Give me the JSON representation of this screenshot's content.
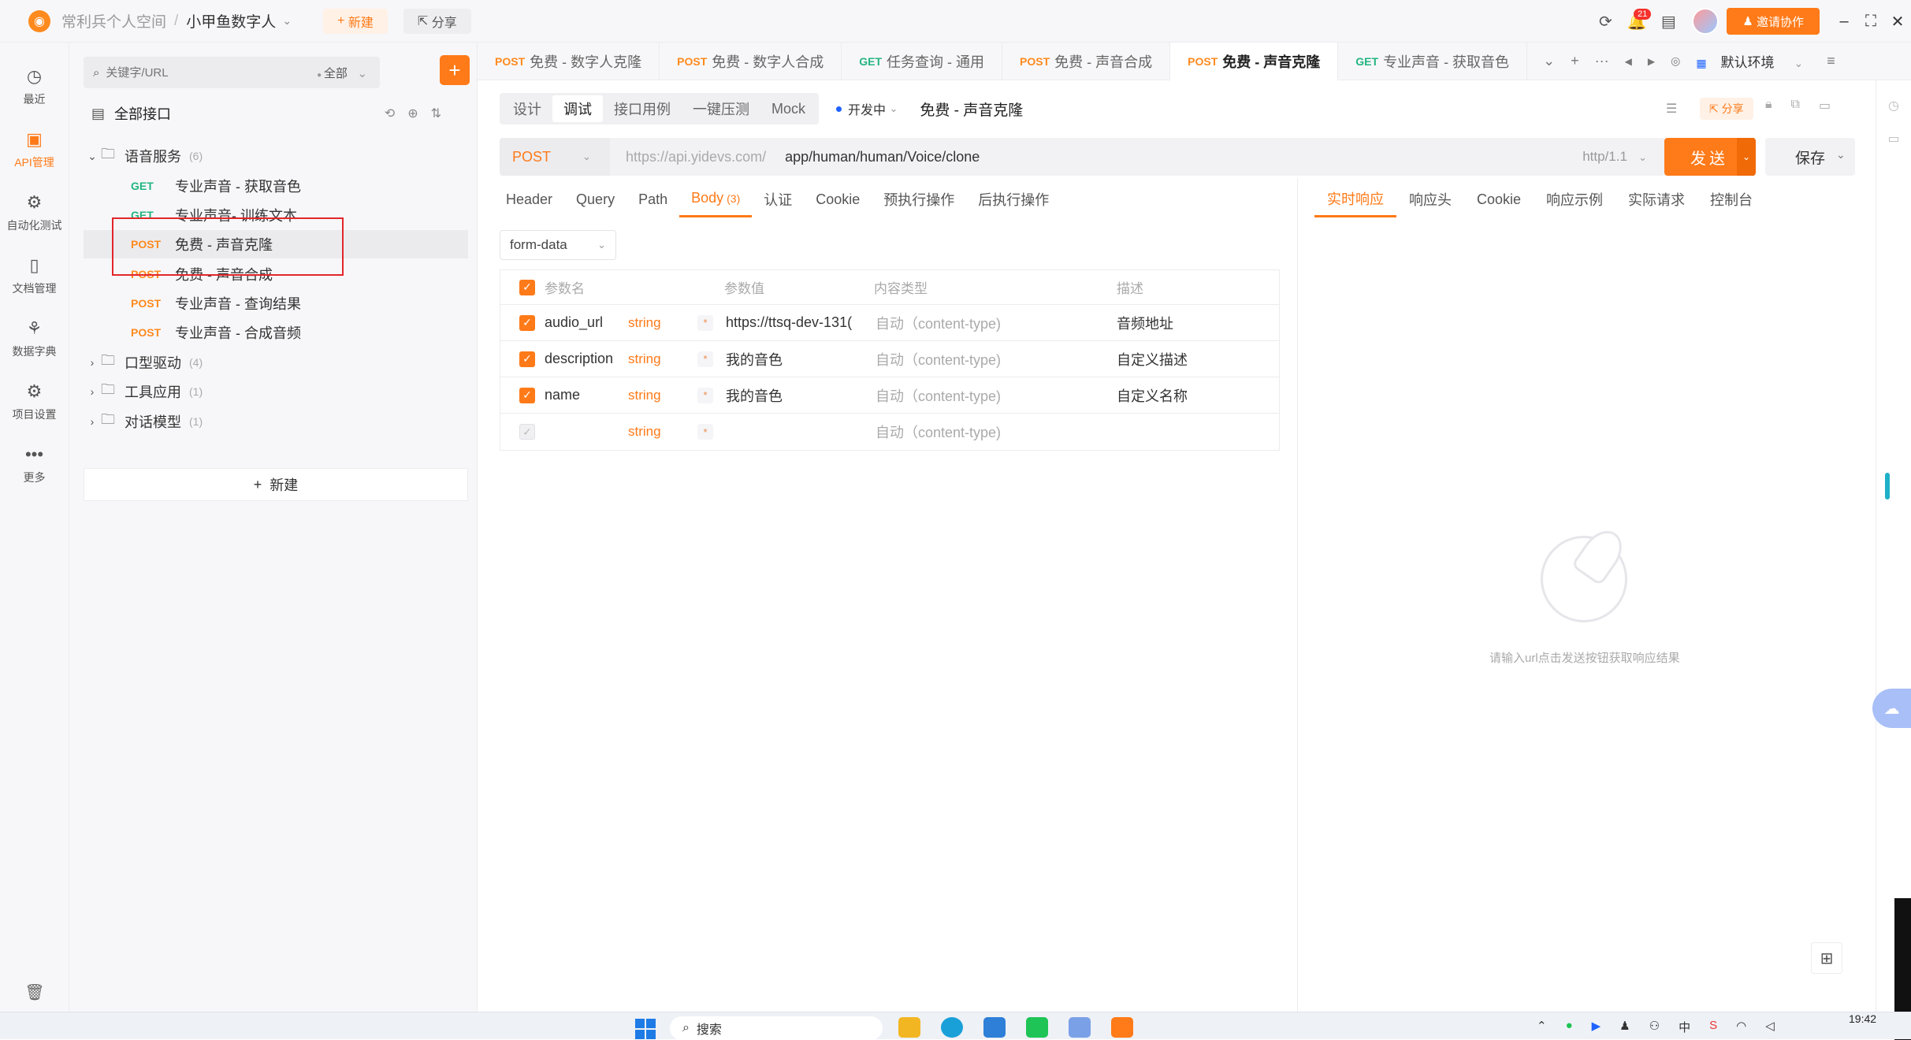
{
  "topbar": {
    "workspace": "常利兵个人空间",
    "project": "小甲鱼数字人",
    "new_label": "新建",
    "share_label": "分享",
    "notification_count": "21",
    "invite_label": "邀请协作"
  },
  "leftnav": {
    "items": [
      {
        "label": "最近",
        "icon": "clock-icon"
      },
      {
        "label": "API管理",
        "icon": "api-icon",
        "active": true
      },
      {
        "label": "自动化测试",
        "icon": "automation-icon"
      },
      {
        "label": "文档管理",
        "icon": "document-icon"
      },
      {
        "label": "数据字典",
        "icon": "dictionary-icon"
      },
      {
        "label": "项目设置",
        "icon": "settings-icon"
      },
      {
        "label": "更多",
        "icon": "more-icon"
      }
    ]
  },
  "tree": {
    "search_placeholder": "关键字/URL",
    "filter_label": "全部",
    "root_label": "全部接口",
    "new_label": "新建",
    "folders": [
      {
        "name": "语音服务",
        "count": "(6)",
        "expanded": true
      },
      {
        "name": "口型驱动",
        "count": "(4)"
      },
      {
        "name": "工具应用",
        "count": "(1)"
      },
      {
        "name": "对话模型",
        "count": "(1)"
      }
    ],
    "items": [
      {
        "method": "GET",
        "name": "专业声音 - 获取音色"
      },
      {
        "method": "GET",
        "name": "专业声音- 训练文本"
      },
      {
        "method": "POST",
        "name": "免费 - 声音克隆"
      },
      {
        "method": "POST",
        "name": "免费 - 声音合成"
      },
      {
        "method": "POST",
        "name": "专业声音 - 查询结果"
      },
      {
        "method": "POST",
        "name": "专业声音 - 合成音频"
      }
    ]
  },
  "tabs": [
    {
      "method": "POST",
      "name": "免费 - 数字人克隆"
    },
    {
      "method": "POST",
      "name": "免费 - 数字人合成"
    },
    {
      "method": "GET",
      "name": "任务查询 - 通用"
    },
    {
      "method": "POST",
      "name": "免费 - 声音合成"
    },
    {
      "method": "POST",
      "name": "免费 - 声音克隆",
      "active": true
    },
    {
      "method": "GET",
      "name": "专业声音 - 获取音色"
    }
  ],
  "env_label": "默认环境",
  "modes": [
    "设计",
    "调试",
    "接口用例",
    "一键压测",
    "Mock"
  ],
  "status_label": "开发中",
  "request_name": "免费 - 声音克隆",
  "share_label": "分享",
  "url": {
    "method": "POST",
    "prefix": "https://api.yidevs.com/",
    "path": "app/human/human/Voice/clone",
    "protocol": "http/1.1"
  },
  "send_label": "发送",
  "save_label": "保存",
  "request_tabs": [
    "Header",
    "Query",
    "Path",
    "Body",
    "认证",
    "Cookie",
    "预执行操作",
    "后执行操作"
  ],
  "body_count": "(3)",
  "response_tabs": [
    "实时响应",
    "响应头",
    "Cookie",
    "响应示例",
    "实际请求",
    "控制台"
  ],
  "body_type": "form-data",
  "params_header": {
    "name": "参数名",
    "value": "参数值",
    "content_type": "内容类型",
    "desc": "描述"
  },
  "params": [
    {
      "name": "audio_url",
      "type": "string",
      "value": "https://ttsq-dev-131(",
      "content_type": "自动（content-type)",
      "desc": "音频地址",
      "checked": true
    },
    {
      "name": "description",
      "type": "string",
      "value": "我的音色",
      "content_type": "自动（content-type)",
      "desc": "自定义描述",
      "checked": true
    },
    {
      "name": "name",
      "type": "string",
      "value": "我的音色",
      "content_type": "自动（content-type)",
      "desc": "自定义名称",
      "checked": true
    },
    {
      "name": "",
      "type": "string",
      "value": "",
      "content_type": "自动（content-type)",
      "desc": "",
      "checked": false
    }
  ],
  "response_empty": "请输入url点击发送按钮获取响应结果",
  "taskbar": {
    "search": "搜索",
    "time": "19:42"
  }
}
